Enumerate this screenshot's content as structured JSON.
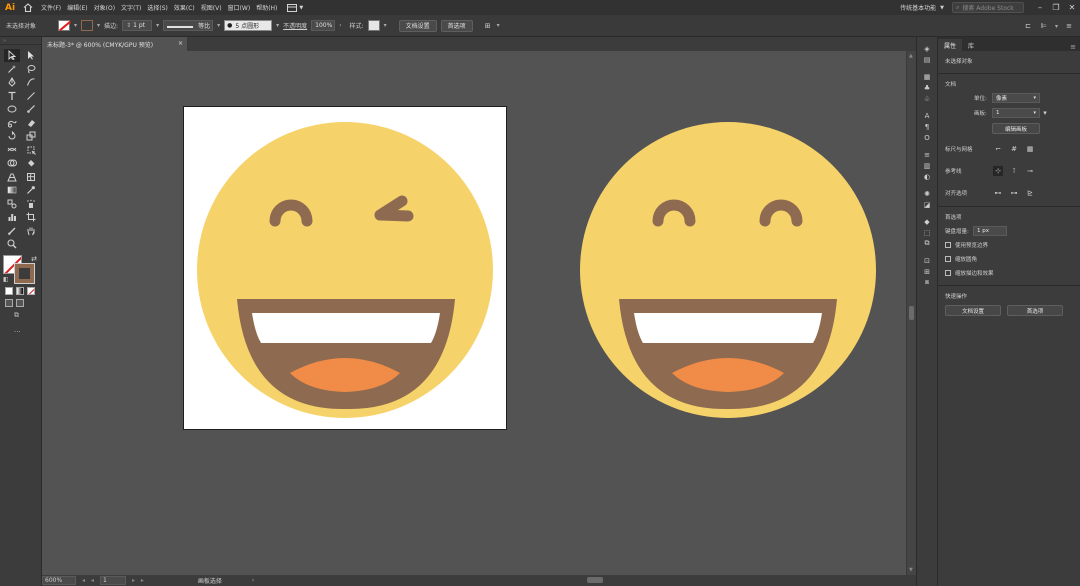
{
  "app": {
    "logo": "Ai",
    "menu": [
      "文件(F)",
      "编辑(E)",
      "对象(O)",
      "文字(T)",
      "选择(S)",
      "效果(C)",
      "视图(V)",
      "窗口(W)",
      "帮助(H)"
    ],
    "workspace": "传统基本功能",
    "search_placeholder": "搜索 Adobe Stock"
  },
  "control": {
    "selection_label": "未选择对象",
    "stroke_label": "描边:",
    "stroke_value": "1 pt",
    "stroke_profile": "等比",
    "brush": "5 点圆形",
    "opacity_label": "不透明度",
    "opacity_value": "100%",
    "style_label": "样式:",
    "doc_setup": "文档设置",
    "preferences": "首选项"
  },
  "document": {
    "tab_title": "未标题-3* @ 600% (CMYK/GPU 预览)",
    "close": "×"
  },
  "status": {
    "zoom": "600%",
    "page": "1",
    "nav_prev": "◂ ◂",
    "nav_next": "▸ ▸",
    "text": "画板选择"
  },
  "properties": {
    "tabs": [
      "属性",
      "库"
    ],
    "no_selection": "未选择对象",
    "document_title": "文档",
    "units_label": "单位:",
    "units_value": "像素",
    "artboard_label": "画板:",
    "artboard_value": "1",
    "edit_artboards": "编辑画板",
    "rulers_grid": "标尺与网格",
    "guides": "参考线",
    "snap": "对齐选项",
    "prefs_title": "首选项",
    "keyboard_increment_label": "键盘增量:",
    "keyboard_increment_value": "1 px",
    "checkbox_preview_bounds": "使用预览边界",
    "checkbox_scale_corners": "缩放圆角",
    "checkbox_scale_strokes": "缩放描边和效果",
    "quick_actions_title": "快速操作",
    "btn_doc_setup": "文档设置",
    "btn_preferences": "首选项"
  },
  "colors": {
    "face": "#f6d36a",
    "feature_brown": "#8e6a50",
    "teeth": "#ffffff",
    "tongue": "#f08c48",
    "canvas_bg": "#535353",
    "panel_bg": "#3c3c3c",
    "accent_logo": "#ff9a00"
  }
}
